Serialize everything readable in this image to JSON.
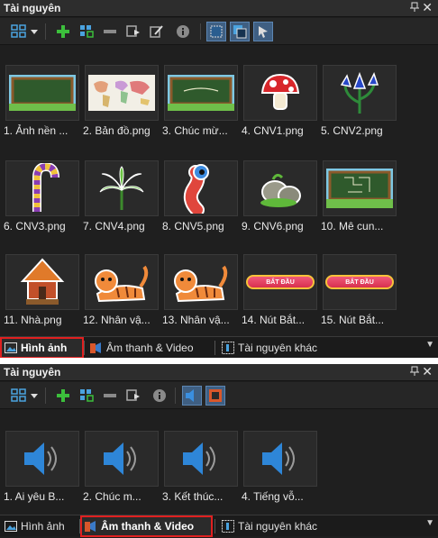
{
  "panel1": {
    "title": "Tài nguyên",
    "items": [
      {
        "label": "1. Ảnh nền ...",
        "icon": "chalkboard-image"
      },
      {
        "label": "2. Bản đồ.png",
        "icon": "world-map-image"
      },
      {
        "label": "3. Chúc mừ...",
        "icon": "congratulations-board-image"
      },
      {
        "label": "4. CNV1.png",
        "icon": "mushroom-image"
      },
      {
        "label": "5. CNV2.png",
        "icon": "blue-flowers-image"
      },
      {
        "label": "6. CNV3.png",
        "icon": "candy-cane-image"
      },
      {
        "label": "7. CNV4.png",
        "icon": "palm-leaves-image"
      },
      {
        "label": "8. CNV5.png",
        "icon": "worm-image"
      },
      {
        "label": "9. CNV6.png",
        "icon": "rocks-image"
      },
      {
        "label": "10. Mê cun...",
        "icon": "maze-board-image"
      },
      {
        "label": "11. Nhà.png",
        "icon": "hut-image"
      },
      {
        "label": "12. Nhân vậ...",
        "icon": "tiger-image"
      },
      {
        "label": "13. Nhân vậ...",
        "icon": "tiger-image"
      },
      {
        "label": "14. Nút Bắt...",
        "icon": "start-button-image",
        "button_text": "BẮT ĐẦU"
      },
      {
        "label": "15. Nút Bắt...",
        "icon": "start-button-image",
        "button_text": "BẮT ĐẦU"
      }
    ],
    "tabs": [
      {
        "label": "Hình ảnh",
        "selected": true
      },
      {
        "label": "Âm thanh & Video",
        "selected": false
      },
      {
        "label": "Tài nguyên khác",
        "selected": false
      }
    ]
  },
  "panel2": {
    "title": "Tài nguyên",
    "items": [
      {
        "label": "1. Ai yêu B...",
        "icon": "speaker-icon"
      },
      {
        "label": "2. Chúc m...",
        "icon": "speaker-icon"
      },
      {
        "label": "3. Kết thúc...",
        "icon": "speaker-icon"
      },
      {
        "label": "4. Tiếng vỗ...",
        "icon": "speaker-icon"
      }
    ],
    "tabs": [
      {
        "label": "Hình ảnh",
        "selected": false
      },
      {
        "label": "Âm thanh & Video",
        "selected": true
      },
      {
        "label": "Tài nguyên khác",
        "selected": false
      }
    ]
  },
  "colors": {
    "highlight": "#e02020",
    "panel_bg": "#1f1f1f",
    "accent": "#3f5f82"
  }
}
